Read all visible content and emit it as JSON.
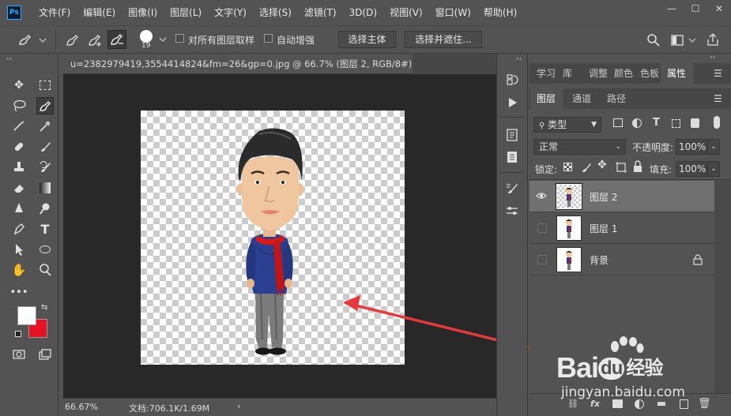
{
  "app": {
    "logo": "Ps"
  },
  "menu": [
    "文件(F)",
    "编辑(E)",
    "图像(I)",
    "图层(L)",
    "文字(Y)",
    "选择(S)",
    "滤镜(T)",
    "3D(D)",
    "视图(V)",
    "窗口(W)",
    "帮助(H)"
  ],
  "window_controls": {
    "minimize": "—",
    "maximize": "☐",
    "close": "✕"
  },
  "options": {
    "brush_size": "19",
    "sample_all_label": "对所有图层取样",
    "auto_enhance_label": "自动增强",
    "select_subject_label": "选择主体",
    "select_and_mask_label": "选择并遮住..."
  },
  "document": {
    "tab_title": "u=2382979419,3554414824&fm=26&gp=0.jpg @ 66.7% (图层 2, RGB/8#) *",
    "close_glyph": "×",
    "zoom": "66.67%",
    "doc_size": "文档:706.1K/1.69M",
    "arrow": "›"
  },
  "colors": {
    "foreground": "#ffffff",
    "background": "#e81123",
    "accent": "#31a8ff",
    "arrow": "#e8393a"
  },
  "panels": {
    "top_tabs": [
      "学习",
      "库",
      "调整",
      "颜色",
      "色板",
      "属性"
    ],
    "active_top_tab": "属性",
    "layer_tabs": [
      "图层",
      "通道",
      "路径"
    ],
    "filter_kind": "类型",
    "blend_mode": "正常",
    "opacity_label": "不透明度:",
    "opacity_value": "100%",
    "lock_label": "锁定:",
    "fill_label": "填充:",
    "fill_value": "100%"
  },
  "layers": [
    {
      "name": "图层 2",
      "visible": true,
      "selected": true,
      "locked": false
    },
    {
      "name": "图层 1",
      "visible": false,
      "selected": false,
      "locked": false
    },
    {
      "name": "背景",
      "visible": false,
      "selected": false,
      "locked": true
    }
  ],
  "footer_icons": [
    "link-icon",
    "fx-icon",
    "mask-icon",
    "adjustment-icon",
    "folder-icon",
    "new-layer-icon",
    "trash-icon"
  ],
  "watermark": {
    "brand": "Bai",
    "brand2": "du",
    "brand3": "经验",
    "url": "jingyan.baidu.com"
  }
}
